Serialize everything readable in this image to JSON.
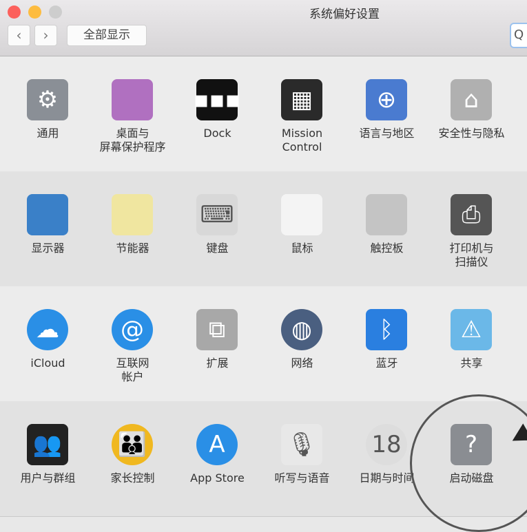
{
  "window": {
    "title": "系统偏好设置",
    "back": "‹",
    "forward": "›",
    "show_all": "全部显示",
    "search_glyph": "Q"
  },
  "rows": [
    [
      {
        "label": "通用",
        "icon": "gear-icon",
        "bg": "#8a8f96",
        "glyph": "⚙"
      },
      {
        "label": "桌面与\n屏幕保护程序",
        "icon": "desktop-screensaver-icon",
        "bg": "#b070c0",
        "glyph": ""
      },
      {
        "label": "Dock",
        "icon": "dock-icon",
        "bg": "#111",
        "glyph": "▪▪▪"
      },
      {
        "label": "Mission\nControl",
        "icon": "mission-control-icon",
        "bg": "#2a2a2a",
        "glyph": "▦"
      },
      {
        "label": "语言与地区",
        "icon": "un-flag-icon",
        "bg": "#4a7bd0",
        "glyph": "⊕"
      },
      {
        "label": "安全性与隐私",
        "icon": "lock-house-icon",
        "bg": "#b0b0b0",
        "glyph": "⌂"
      }
    ],
    [
      {
        "label": "显示器",
        "icon": "display-icon",
        "bg": "#3a80c8",
        "glyph": ""
      },
      {
        "label": "节能器",
        "icon": "lightbulb-icon",
        "bg": "#f0e6a0",
        "glyph": ""
      },
      {
        "label": "键盘",
        "icon": "keyboard-icon",
        "bg": "#d8d8d8",
        "glyph": "⌨"
      },
      {
        "label": "鼠标",
        "icon": "mouse-icon",
        "bg": "#f4f4f4",
        "glyph": ""
      },
      {
        "label": "触控板",
        "icon": "trackpad-icon",
        "bg": "#c4c4c4",
        "glyph": ""
      },
      {
        "label": "打印机与\n扫描仪",
        "icon": "printer-icon",
        "bg": "#555",
        "glyph": "⎙"
      }
    ],
    [
      {
        "label": "iCloud",
        "icon": "icloud-icon",
        "bg": "#2a8fe6",
        "glyph": "☁"
      },
      {
        "label": "互联网\n帐户",
        "icon": "at-sign-icon",
        "bg": "#2a8fe6",
        "glyph": "@"
      },
      {
        "label": "扩展",
        "icon": "extensions-icon",
        "bg": "#a8a8a8",
        "glyph": "⧉"
      },
      {
        "label": "网络",
        "icon": "network-globe-icon",
        "bg": "#4a5f80",
        "glyph": "◍"
      },
      {
        "label": "蓝牙",
        "icon": "bluetooth-icon",
        "bg": "#2a7fe0",
        "glyph": "ᛒ"
      },
      {
        "label": "共享",
        "icon": "sharing-folder-icon",
        "bg": "#6bb8e8",
        "glyph": "⚠"
      }
    ],
    [
      {
        "label": "用户与群组",
        "icon": "users-groups-icon",
        "bg": "#222",
        "glyph": "👥"
      },
      {
        "label": "家长控制",
        "icon": "parental-controls-icon",
        "bg": "#f0b820",
        "glyph": "👪"
      },
      {
        "label": "App Store",
        "icon": "app-store-icon",
        "bg": "#2a8fe6",
        "glyph": "A"
      },
      {
        "label": "听写与语音",
        "icon": "microphone-icon",
        "bg": "#e8e8e8",
        "glyph": "🎙"
      },
      {
        "label": "日期与时间",
        "icon": "clock-calendar-icon",
        "bg": "#ddd",
        "glyph": "18"
      },
      {
        "label": "启动磁盘",
        "icon": "startup-disk-icon",
        "bg": "#8a8d92",
        "glyph": "?"
      }
    ]
  ],
  "row_colors": [
    "#ececec",
    "#e2e2e2",
    "#ececec",
    "#e2e2e2"
  ],
  "traffic_lights": [
    "#fc605c",
    "#fdbc40",
    "#cdcdcd"
  ]
}
